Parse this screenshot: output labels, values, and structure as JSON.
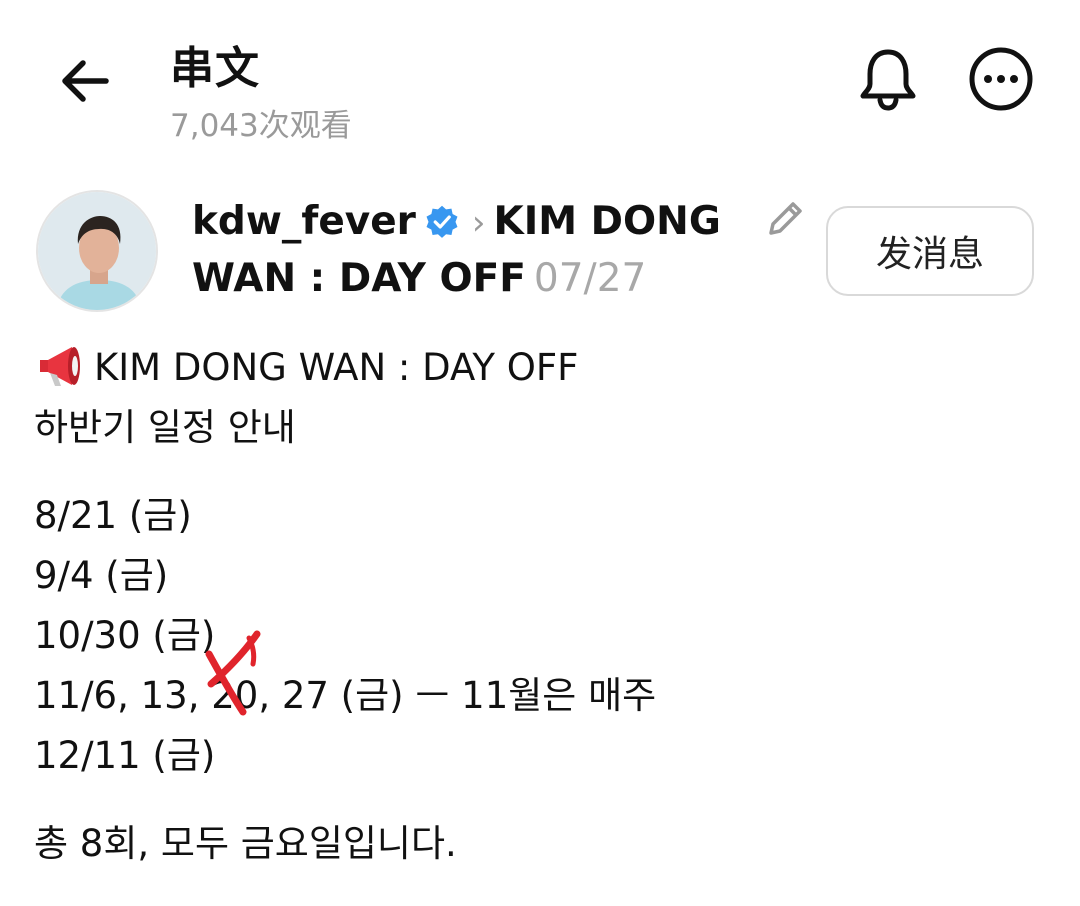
{
  "header": {
    "title": "串文",
    "views": "7,043次观看",
    "back_icon": "arrow-left-icon",
    "bell_icon": "bell-icon",
    "more_icon": "more-horizontal-icon"
  },
  "author": {
    "username": "kdw_fever",
    "verified": true,
    "source_title": "KIM DONG WAN : DAY OFF",
    "date": "07/27",
    "message_button": "发消息",
    "accent_color": "#3897f0"
  },
  "post": {
    "intro_line1": "KIM DONG WAN : DAY OFF",
    "intro_line2": "하반기 일정 안내",
    "schedule": {
      "line1": "8/21 (금)",
      "line2": "9/4 (금)",
      "line3": "10/30 (금)",
      "line4_prefix": "11/6, 13, ",
      "line4_struck": "20",
      "line4_suffix": ", 27 (금) ㅡ 11월은 매주",
      "line5": "12/11 (금)"
    },
    "summary": "총 8회, 모두 금요일입니다."
  }
}
